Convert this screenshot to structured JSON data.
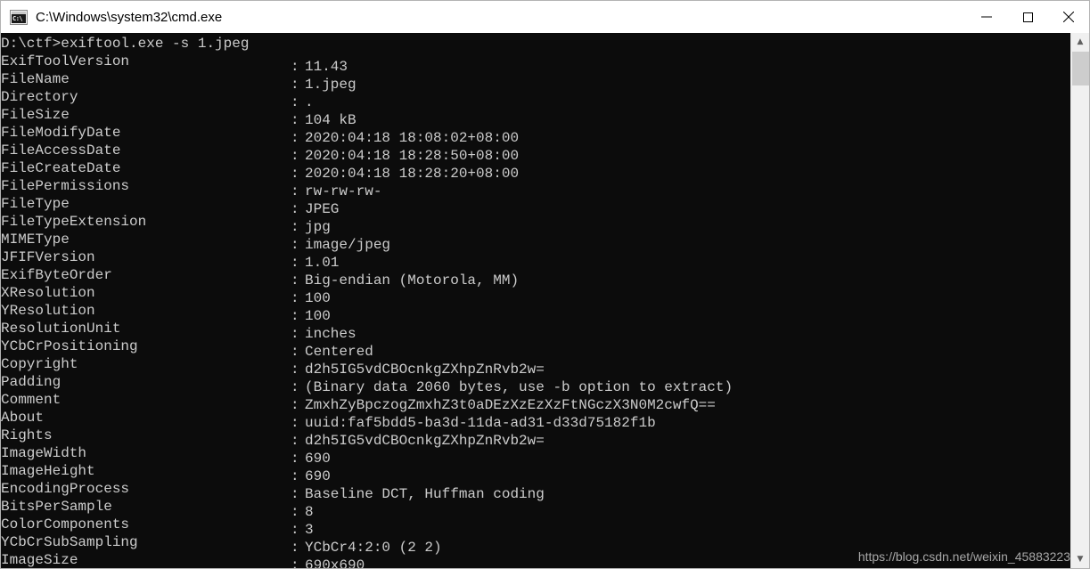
{
  "window": {
    "title": "C:\\Windows\\system32\\cmd.exe",
    "icon": "cmd-icon",
    "icon_text": "C:\\",
    "background_color": "#0c0c0c",
    "text_color": "#cccccc",
    "titlebar_color": "#ffffff"
  },
  "caption_buttons": [
    {
      "name": "minimize-button",
      "glyph": "minimize-icon"
    },
    {
      "name": "maximize-button",
      "glyph": "maximize-icon"
    },
    {
      "name": "close-button",
      "glyph": "close-icon"
    }
  ],
  "console": {
    "prompt_line": "D:\\ctf>exiftool.exe -s 1.jpeg",
    "separator": ":",
    "rows": [
      {
        "key": "ExifToolVersion",
        "value": "11.43"
      },
      {
        "key": "FileName",
        "value": "1.jpeg"
      },
      {
        "key": "Directory",
        "value": "."
      },
      {
        "key": "FileSize",
        "value": "104 kB"
      },
      {
        "key": "FileModifyDate",
        "value": "2020:04:18 18:08:02+08:00"
      },
      {
        "key": "FileAccessDate",
        "value": "2020:04:18 18:28:50+08:00"
      },
      {
        "key": "FileCreateDate",
        "value": "2020:04:18 18:28:20+08:00"
      },
      {
        "key": "FilePermissions",
        "value": "rw-rw-rw-"
      },
      {
        "key": "FileType",
        "value": "JPEG"
      },
      {
        "key": "FileTypeExtension",
        "value": "jpg"
      },
      {
        "key": "MIMEType",
        "value": "image/jpeg"
      },
      {
        "key": "JFIFVersion",
        "value": "1.01"
      },
      {
        "key": "ExifByteOrder",
        "value": "Big-endian (Motorola, MM)"
      },
      {
        "key": "XResolution",
        "value": "100"
      },
      {
        "key": "YResolution",
        "value": "100"
      },
      {
        "key": "ResolutionUnit",
        "value": "inches"
      },
      {
        "key": "YCbCrPositioning",
        "value": "Centered"
      },
      {
        "key": "Copyright",
        "value": "d2h5IG5vdCBOcnkgZXhpZnRvb2w="
      },
      {
        "key": "Padding",
        "value": "(Binary data 2060 bytes, use -b option to extract)"
      },
      {
        "key": "Comment",
        "value": "ZmxhZyBpczogZmxhZ3t0aDEzXzEzXzFtNGczX3N0M2cwfQ=="
      },
      {
        "key": "About",
        "value": "uuid:faf5bdd5-ba3d-11da-ad31-d33d75182f1b"
      },
      {
        "key": "Rights",
        "value": "d2h5IG5vdCBOcnkgZXhpZnRvb2w="
      },
      {
        "key": "ImageWidth",
        "value": "690"
      },
      {
        "key": "ImageHeight",
        "value": "690"
      },
      {
        "key": "EncodingProcess",
        "value": "Baseline DCT, Huffman coding"
      },
      {
        "key": "BitsPerSample",
        "value": "8"
      },
      {
        "key": "ColorComponents",
        "value": "3"
      },
      {
        "key": "YCbCrSubSampling",
        "value": "YCbCr4:2:0 (2 2)"
      },
      {
        "key": "ImageSize",
        "value": "690x690"
      }
    ]
  },
  "watermark": {
    "text": "https://blog.csdn.net/weixin_45883223"
  },
  "scrollbar": {
    "up_arrow": "chevron-up-icon",
    "down_arrow": "chevron-down-icon",
    "thumb_position_pct": 3
  }
}
